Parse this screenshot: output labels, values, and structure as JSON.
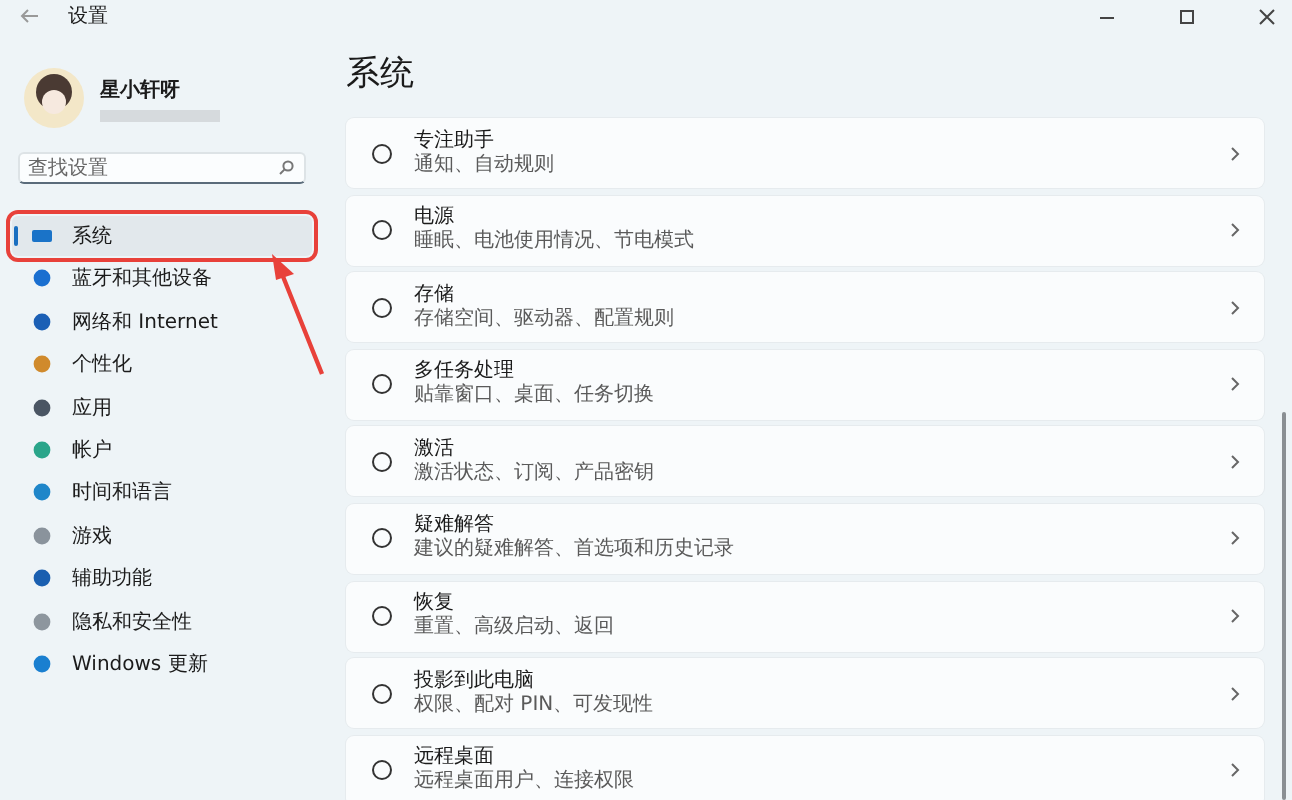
{
  "window": {
    "title": "设置"
  },
  "profile": {
    "name": "星小轩呀"
  },
  "search": {
    "placeholder": "查找设置"
  },
  "sidebar": {
    "items": [
      {
        "label": "系统",
        "selected": true
      },
      {
        "label": "蓝牙和其他设备",
        "selected": false
      },
      {
        "label": "网络和 Internet",
        "selected": false
      },
      {
        "label": "个性化",
        "selected": false
      },
      {
        "label": "应用",
        "selected": false
      },
      {
        "label": "帐户",
        "selected": false
      },
      {
        "label": "时间和语言",
        "selected": false
      },
      {
        "label": "游戏",
        "selected": false
      },
      {
        "label": "辅助功能",
        "selected": false
      },
      {
        "label": "隐私和安全性",
        "selected": false
      },
      {
        "label": "Windows 更新",
        "selected": false
      }
    ]
  },
  "page": {
    "title": "系统"
  },
  "cards": [
    {
      "title": "专注助手",
      "subtitle": "通知、自动规则"
    },
    {
      "title": "电源",
      "subtitle": "睡眠、电池使用情况、节电模式"
    },
    {
      "title": "存储",
      "subtitle": "存储空间、驱动器、配置规则"
    },
    {
      "title": "多任务处理",
      "subtitle": "贴靠窗口、桌面、任务切换"
    },
    {
      "title": "激活",
      "subtitle": "激活状态、订阅、产品密钥"
    },
    {
      "title": "疑难解答",
      "subtitle": "建议的疑难解答、首选项和历史记录"
    },
    {
      "title": "恢复",
      "subtitle": "重置、高级启动、返回"
    },
    {
      "title": "投影到此电脑",
      "subtitle": "权限、配对 PIN、可发现性"
    },
    {
      "title": "远程桌面",
      "subtitle": "远程桌面用户、连接权限"
    }
  ]
}
